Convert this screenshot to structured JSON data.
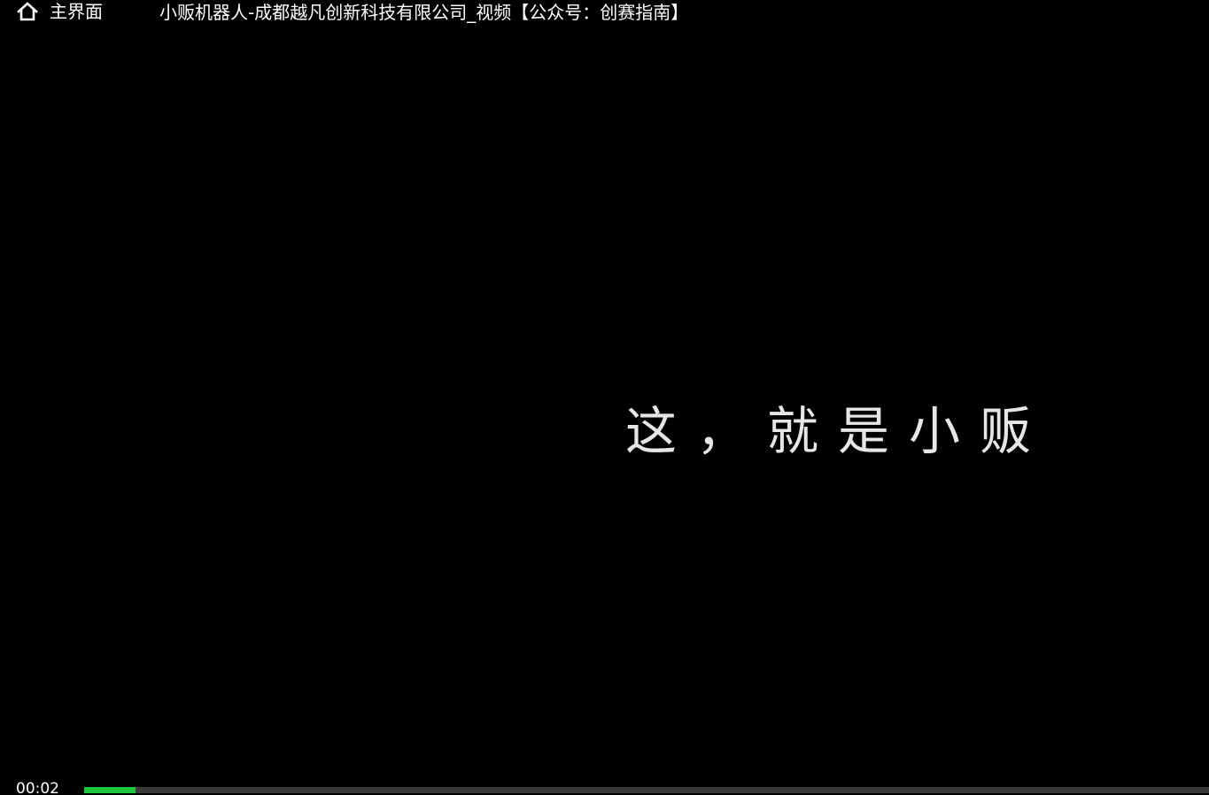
{
  "header": {
    "home_label": "主界面",
    "home_icon": "home-icon",
    "title": "小贩机器人-成都越凡创新科技有限公司_视频【公众号：创赛指南】"
  },
  "video": {
    "subtitle": "这，就是小贩"
  },
  "controls": {
    "current_time": "00:02",
    "progress_fraction": 0.046,
    "progress_color": "#1ec83c",
    "track_color": "#3a3a3a"
  }
}
